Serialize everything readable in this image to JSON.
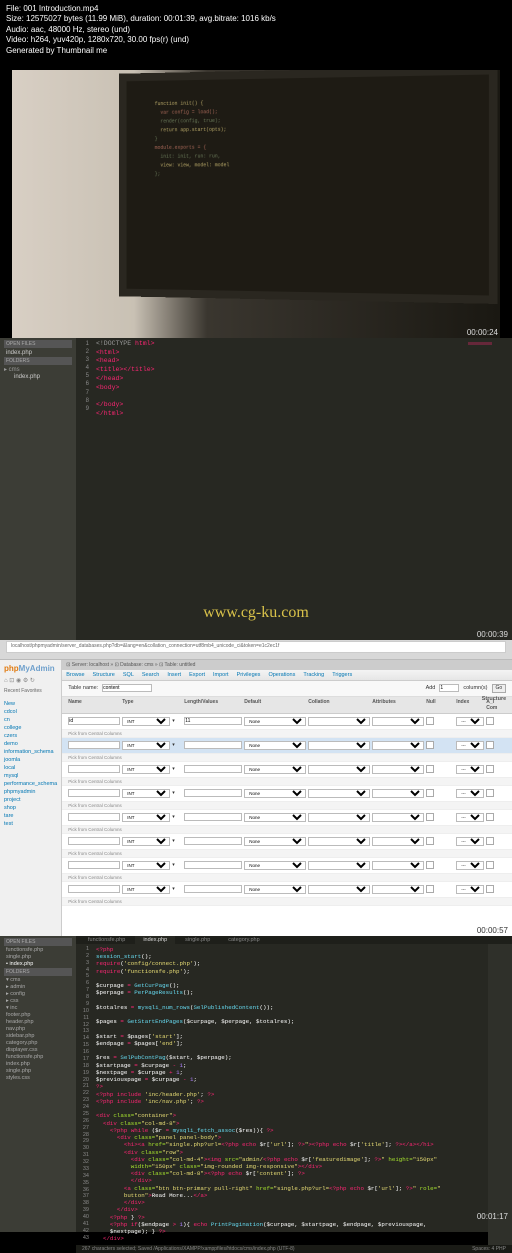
{
  "header": {
    "file": "File: 001 Introduction.mp4",
    "size": "Size: 12575027 bytes (11.99 MiB), duration: 00:01:39, avg.bitrate: 1016 kb/s",
    "audio": "Audio: aac, 48000 Hz, stereo (und)",
    "video": "Video: h264, yuv420p, 1280x720, 30.00 fps(r) (und)",
    "gen": "Generated by Thumbnail me"
  },
  "timestamps": {
    "t1": "00:00:24",
    "t2": "00:00:39",
    "t3": "00:00:57",
    "t4": "00:01:17"
  },
  "watermark": "www.cg-ku.com",
  "thumb2": {
    "sidebar": {
      "open": "OPEN FILES",
      "file1": "index.php",
      "folders": "FOLDERS",
      "proj": "▸ cms",
      "sub": "index.php"
    },
    "lines": [
      "1",
      "2",
      "3",
      "4",
      "5",
      "6",
      "7",
      "8",
      "9"
    ],
    "code": {
      "l1a": "<!DOCTYPE",
      "l1b": " html>",
      "l2": "<html>",
      "l3": "<head>",
      "l4a": "    <title>",
      "l4b": "</title>",
      "l5": "</head>",
      "l6": "<body>",
      "l7": "",
      "l8": "</body>",
      "l9": "</html>"
    }
  },
  "thumb3": {
    "url": "localhost/phpmyadmin/server_databases.php?db=&lang=en&collation_connection=utf8mb4_unicode_ci&token=e1c2ec1f",
    "logo": {
      "php": "php",
      "my": "MyAdmin"
    },
    "sideTabs": "Recent  Favorites",
    "tree": [
      "New",
      "cdcol",
      "cn",
      "college",
      "czers",
      "demo",
      "information_schema",
      "joomla",
      "local",
      "mysql",
      "performance_schema",
      "phpmyadmin",
      "project",
      "shop",
      "tare",
      "test"
    ],
    "crumb": "⊡ Server: localhost »  ⊡ Database: cms »  ⊡ Table: untitled",
    "tabs": [
      "Browse",
      "Structure",
      "SQL",
      "Search",
      "Insert",
      "Export",
      "Import",
      "Privileges",
      "Operations",
      "Tracking",
      "Triggers"
    ],
    "toolbar": {
      "tname": "Table name:",
      "tval": "content",
      "add": "Add",
      "col": "column(s)",
      "go": "Go",
      "one": "1"
    },
    "structLabel": "Structure",
    "head": [
      "Name",
      "Type",
      "",
      "Length/Values",
      "Default",
      "Collation",
      "Attributes",
      "Null",
      "Index",
      "A_I   Com"
    ],
    "row": {
      "id": "id",
      "type": "INT",
      "len": "11",
      "def": "None",
      "idx": "---"
    },
    "pick": "Pick from Central Columns"
  },
  "thumb4": {
    "sidebar": {
      "open": "OPEN FILES",
      "f_func": "functionsfe.php",
      "f_single": "single.php",
      "f_index": "• index.php",
      "folders": "FOLDERS",
      "proj": "▾ cms",
      "tree": [
        "▸ admin",
        "▸ config",
        "▸ css",
        "▾ inc",
        "    footer.php",
        "    header.php",
        "    nav.php",
        "    sidebar.php",
        "  category.php",
        "  displayer.css",
        "  functionsfe.php",
        "  index.php",
        "  single.php",
        "  styles.css"
      ]
    },
    "tabs": [
      "functionsfe.php",
      "index.php",
      "single.php",
      "category.php"
    ],
    "lines": [
      "1",
      "2",
      "3",
      "4",
      "5",
      "6",
      "7",
      "8",
      "9",
      "10",
      "11",
      "12",
      "13",
      "14",
      "15",
      "16",
      "17",
      "18",
      "19",
      "20",
      "21",
      "22",
      "23",
      "24",
      "25",
      "26",
      "27",
      "28",
      "29",
      "30",
      "31",
      "32",
      "33",
      "34",
      "35",
      "36",
      "37",
      "38",
      "39",
      "40",
      "41",
      "42",
      "43"
    ],
    "status": {
      "left": "267 characters selected; Saved /Applications/XAMPP/xamppfiles/htdocs/cms/index.php (UTF-8)",
      "right": "Spaces: 4      PHP"
    }
  }
}
